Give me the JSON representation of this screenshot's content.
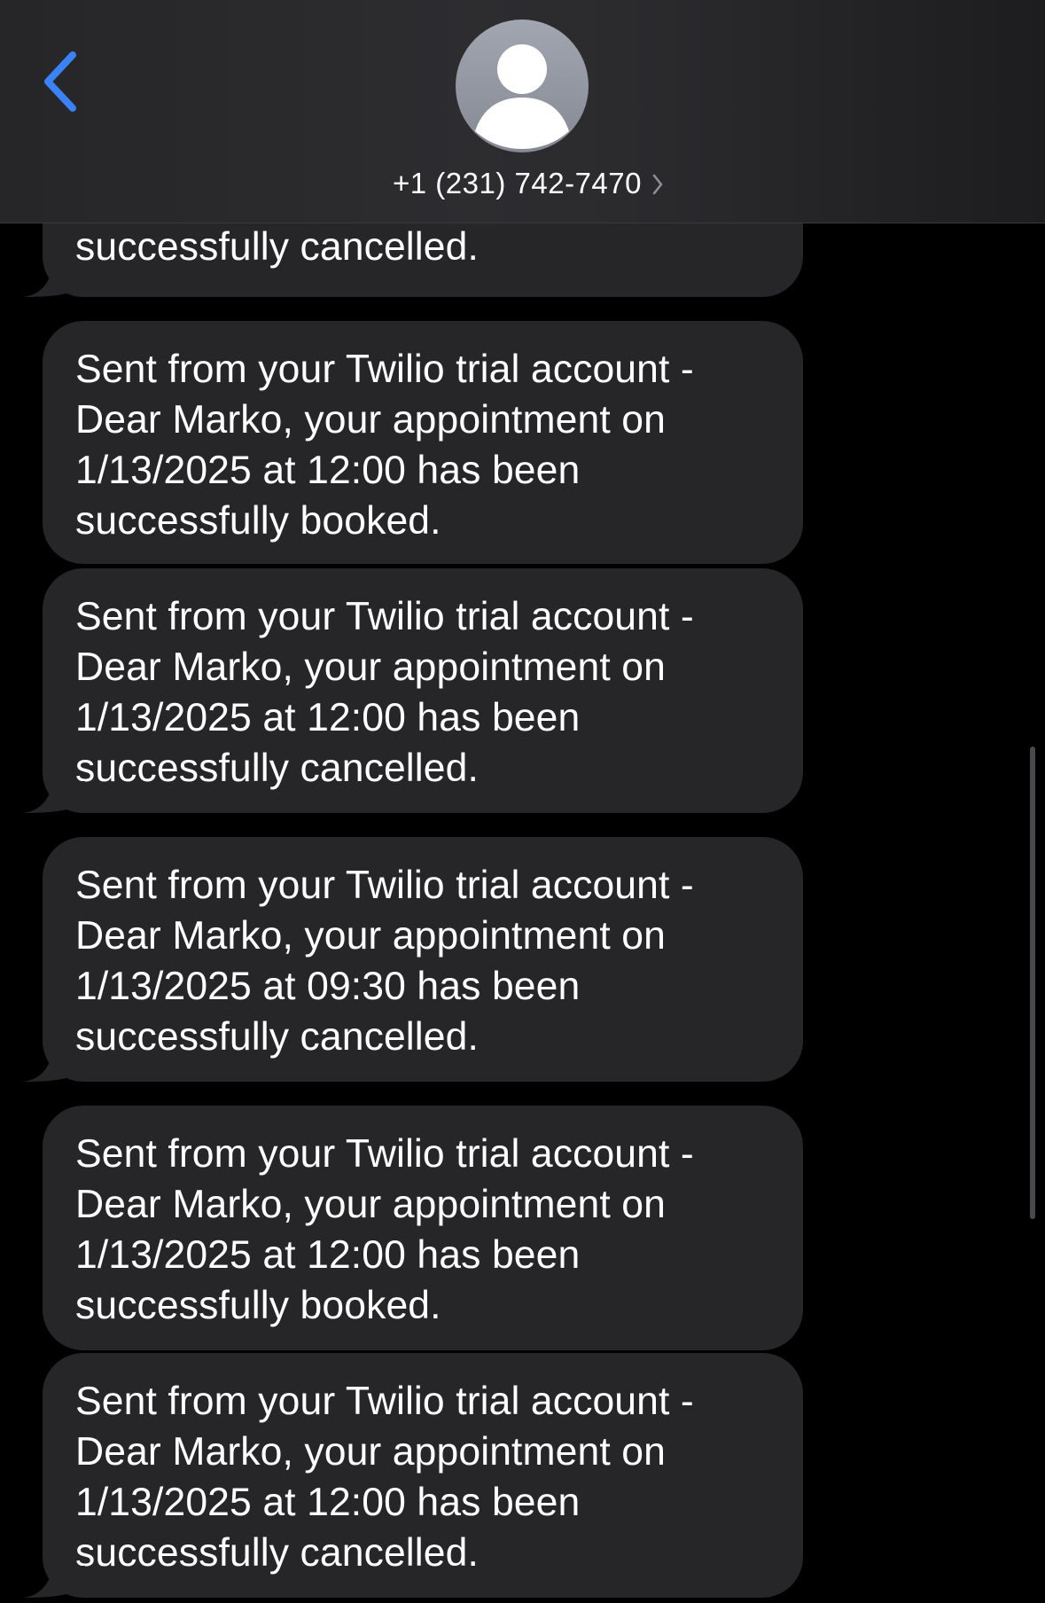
{
  "header": {
    "contact": "+1 (231) 742-7470"
  },
  "thread": {
    "messages": [
      {
        "lines": [
          "successfully cancelled."
        ]
      },
      {
        "lines": [
          "Sent from your Twilio trial account -",
          "Dear Marko, your appointment on",
          "1/13/2025 at 12:00 has been",
          "successfully booked."
        ]
      },
      {
        "lines": [
          "Sent from your Twilio trial account -",
          "Dear Marko, your appointment on",
          "1/13/2025 at 12:00 has been",
          "successfully cancelled."
        ]
      },
      {
        "lines": [
          "Sent from your Twilio trial account -",
          "Dear Marko, your appointment on",
          "1/13/2025 at 09:30 has been",
          "successfully cancelled."
        ]
      },
      {
        "lines": [
          "Sent from your Twilio trial account -",
          "Dear Marko, your appointment on",
          "1/13/2025 at 12:00 has been",
          "successfully booked."
        ]
      },
      {
        "lines": [
          "Sent from your Twilio trial account -",
          "Dear Marko, your appointment on",
          "1/13/2025 at 12:00 has been",
          "successfully cancelled."
        ]
      }
    ]
  },
  "colors": {
    "accent": "#3b82f6",
    "bubble": "#262628",
    "background": "#000000",
    "avatar": "#9a9ea8"
  },
  "icons": {
    "back": "chevron-left-icon",
    "avatar": "person-icon",
    "details": "chevron-right-icon"
  }
}
